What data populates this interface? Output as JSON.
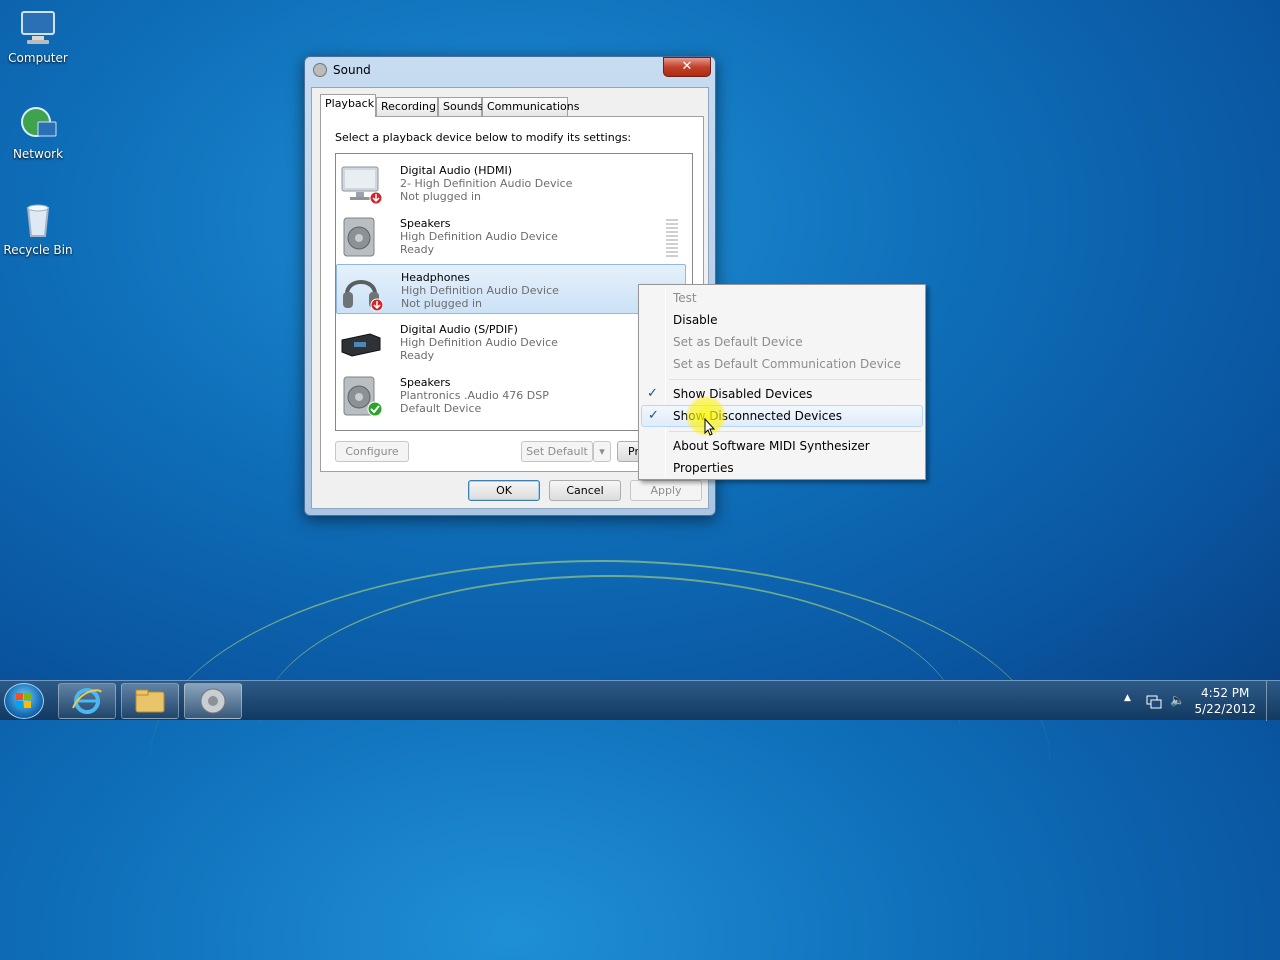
{
  "desktop": {
    "icons": [
      {
        "label": "Computer"
      },
      {
        "label": "Network"
      },
      {
        "label": "Recycle Bin"
      }
    ]
  },
  "window": {
    "title": "Sound",
    "close_glyph": "✕",
    "tabs": [
      "Playback",
      "Recording",
      "Sounds",
      "Communications"
    ],
    "instruction": "Select a playback device below to modify its settings:",
    "devices": [
      {
        "name": "Digital Audio (HDMI)",
        "sub": "2- High Definition Audio Device",
        "status": "Not plugged in",
        "icon": "monitor-icon",
        "badge": "unplugged"
      },
      {
        "name": "Speakers",
        "sub": "High Definition Audio Device",
        "status": "Ready",
        "icon": "speaker-icon",
        "badge": "none"
      },
      {
        "name": "Headphones",
        "sub": "High Definition Audio Device",
        "status": "Not plugged in",
        "icon": "headphones-icon",
        "badge": "unplugged"
      },
      {
        "name": "Digital Audio (S/PDIF)",
        "sub": "High Definition Audio Device",
        "status": "Ready",
        "icon": "receiver-icon",
        "badge": "none"
      },
      {
        "name": "Speakers",
        "sub": "Plantronics .Audio 476 DSP",
        "status": "Default Device",
        "icon": "speaker-icon",
        "badge": "default"
      }
    ],
    "buttons": {
      "configure": "Configure",
      "set_default": "Set Default",
      "properties_partial": "Pr",
      "ok": "OK",
      "cancel": "Cancel",
      "apply": "Apply"
    }
  },
  "context_menu": {
    "items": [
      {
        "label": "Test",
        "enabled": false,
        "checked": false
      },
      {
        "label": "Disable",
        "enabled": true,
        "checked": false
      },
      {
        "label": "Set as Default Device",
        "enabled": false,
        "checked": false
      },
      {
        "label": "Set as Default Communication Device",
        "enabled": false,
        "checked": false
      },
      {
        "label": "Show Disabled Devices",
        "enabled": true,
        "checked": true
      },
      {
        "label": "Show Disconnected Devices",
        "enabled": true,
        "checked": true
      },
      {
        "label": "About Software MIDI Synthesizer",
        "enabled": true,
        "checked": false
      },
      {
        "label": "Properties",
        "enabled": true,
        "checked": false
      }
    ],
    "check_glyph": "✓"
  },
  "taskbar": {
    "clock_time": "4:52 PM",
    "clock_date": "5/22/2012",
    "tray_arrow": "▲",
    "volume_glyph": "🔈"
  },
  "colors": {
    "accent": "#3399ff",
    "default_check": "#2aa52a",
    "unplugged": "#d0262b"
  }
}
